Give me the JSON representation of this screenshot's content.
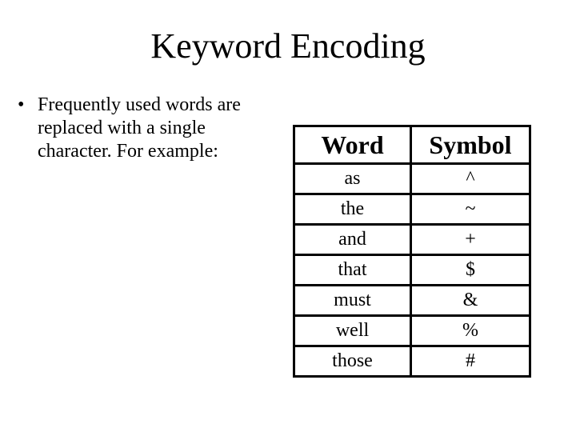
{
  "slide": {
    "title": "Keyword Encoding",
    "bullet": "Frequently used words are replaced with a single character. For example:",
    "bullet_marker": "•"
  },
  "table": {
    "headers": [
      "Word",
      "Symbol"
    ],
    "rows": [
      {
        "word": "as",
        "symbol": "^"
      },
      {
        "word": "the",
        "symbol": "~"
      },
      {
        "word": "and",
        "symbol": "+"
      },
      {
        "word": "that",
        "symbol": "$"
      },
      {
        "word": "must",
        "symbol": "&"
      },
      {
        "word": "well",
        "symbol": "%"
      },
      {
        "word": "those",
        "symbol": "#"
      }
    ]
  }
}
